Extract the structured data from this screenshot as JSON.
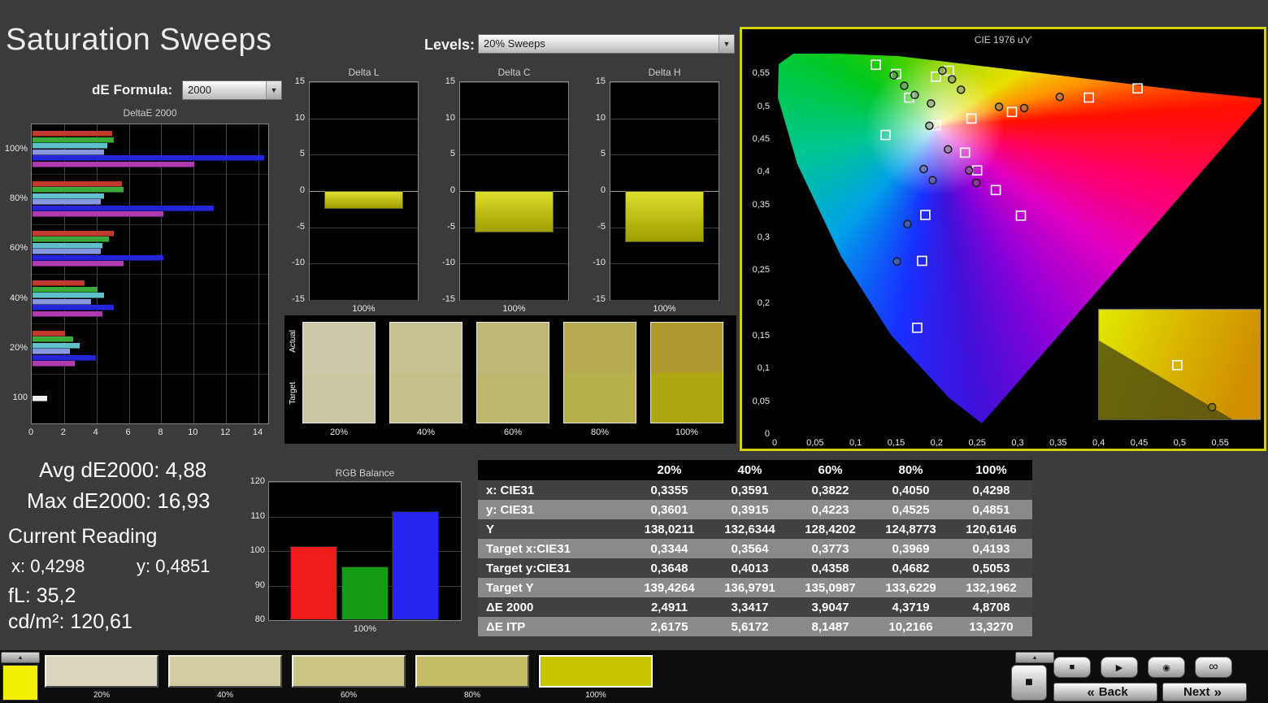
{
  "window": {
    "title": "Saturation Sweeps"
  },
  "controls": {
    "de_formula_label": "dE Formula:",
    "de_formula_value": "2000",
    "levels_label": "Levels:",
    "levels_value": "20% Sweeps",
    "dropdown_arrow": "▼"
  },
  "stats": {
    "avg": "Avg dE2000: 4,88",
    "max": "Max dE2000: 16,93",
    "current_reading": "Current Reading",
    "x": "x: 0,4298",
    "y": "y: 0,4851",
    "fl": "fL: 35,2",
    "cd": "cd/m²: 120,61"
  },
  "chart_data": [
    {
      "id": "deltaE2000",
      "type": "bar",
      "orientation": "horizontal",
      "title": "DeltaE 2000",
      "xlim": [
        0,
        14.6
      ],
      "xticks": [
        0,
        2,
        4,
        6,
        8,
        10,
        12,
        14
      ],
      "series_colors": [
        "#c23a2e",
        "#3aa83a",
        "#62c0cc",
        "#8898e0",
        "#2424d8",
        "#b03ab0"
      ],
      "groups": [
        {
          "label": "100%",
          "values": [
            4.9,
            5.0,
            4.6,
            4.4,
            14.3,
            10.0
          ]
        },
        {
          "label": "80%",
          "values": [
            5.5,
            5.6,
            4.4,
            4.2,
            11.2,
            8.1
          ]
        },
        {
          "label": "60%",
          "values": [
            5.0,
            4.7,
            4.3,
            4.2,
            8.1,
            5.6
          ]
        },
        {
          "label": "40%",
          "values": [
            3.2,
            4.0,
            4.4,
            3.6,
            5.0,
            4.3
          ]
        },
        {
          "label": "20%",
          "values": [
            2.0,
            2.5,
            2.9,
            2.3,
            3.9,
            2.6
          ]
        },
        {
          "label": "100",
          "values": [
            0.9
          ],
          "colors": [
            "#f0f0f0"
          ]
        }
      ]
    },
    {
      "id": "delta_l",
      "type": "bar",
      "title": "Delta L",
      "ylim": [
        -15,
        15
      ],
      "yticks": [
        15,
        10,
        5,
        0,
        -5,
        -10,
        -15
      ],
      "categories": [
        "100%"
      ],
      "values": [
        -2.5
      ],
      "bar_color": "#cccc00"
    },
    {
      "id": "delta_c",
      "type": "bar",
      "title": "Delta C",
      "ylim": [
        -15,
        15
      ],
      "yticks": [
        15,
        10,
        5,
        0,
        -5,
        -10,
        -15
      ],
      "categories": [
        "100%"
      ],
      "values": [
        -5.7
      ],
      "bar_color": "#cccc00"
    },
    {
      "id": "delta_h",
      "type": "bar",
      "title": "Delta H",
      "ylim": [
        -15,
        15
      ],
      "yticks": [
        15,
        10,
        5,
        0,
        -5,
        -10,
        -15
      ],
      "categories": [
        "100%"
      ],
      "values": [
        -7.1
      ],
      "bar_color": "#cccc00"
    },
    {
      "id": "rgb_balance",
      "type": "bar",
      "title": "RGB Balance",
      "ylim": [
        80,
        120
      ],
      "yticks": [
        120,
        110,
        100,
        90,
        80
      ],
      "categories": [
        "100%"
      ],
      "series": [
        {
          "name": "red",
          "color": "#ee1c1c",
          "value": 101.5
        },
        {
          "name": "green",
          "color": "#149c14",
          "value": 95.5
        },
        {
          "name": "blue",
          "color": "#2626ee",
          "value": 111.5
        }
      ]
    },
    {
      "id": "cie1976",
      "type": "scatter",
      "title": "CIE 1976 u'v'",
      "xlim": [
        0,
        0.6
      ],
      "ylim": [
        0,
        0.58
      ],
      "xtick_labels": [
        "0",
        "0,05",
        "0,1",
        "0,15",
        "0,2",
        "0,25",
        "0,3",
        "0,35",
        "0,4",
        "0,45",
        "0,5",
        "0,55"
      ],
      "ytick_labels": [
        "0,55",
        "0,5",
        "0,45",
        "0,4",
        "0,35",
        "0,3",
        "0,25",
        "0,2",
        "0,15",
        "0,1",
        "0,05",
        "0"
      ],
      "targets_uv": [
        [
          0.125,
          0.563
        ],
        [
          0.15,
          0.549
        ],
        [
          0.215,
          0.554
        ],
        [
          0.199,
          0.545
        ],
        [
          0.166,
          0.513
        ],
        [
          0.448,
          0.527
        ],
        [
          0.388,
          0.513
        ],
        [
          0.293,
          0.491
        ],
        [
          0.243,
          0.481
        ],
        [
          0.199,
          0.471
        ],
        [
          0.137,
          0.456
        ],
        [
          0.235,
          0.429
        ],
        [
          0.25,
          0.402
        ],
        [
          0.273,
          0.372
        ],
        [
          0.304,
          0.333
        ],
        [
          0.186,
          0.334
        ],
        [
          0.182,
          0.264
        ],
        [
          0.176,
          0.162
        ]
      ],
      "measurements_uv": [
        [
          0.147,
          0.547
        ],
        [
          0.16,
          0.531
        ],
        [
          0.173,
          0.517
        ],
        [
          0.193,
          0.504
        ],
        [
          0.207,
          0.554
        ],
        [
          0.219,
          0.541
        ],
        [
          0.23,
          0.525
        ],
        [
          0.277,
          0.499
        ],
        [
          0.308,
          0.497
        ],
        [
          0.352,
          0.514
        ],
        [
          0.191,
          0.47
        ],
        [
          0.214,
          0.434
        ],
        [
          0.184,
          0.404
        ],
        [
          0.195,
          0.387
        ],
        [
          0.24,
          0.402
        ],
        [
          0.249,
          0.383
        ],
        [
          0.164,
          0.32
        ],
        [
          0.151,
          0.263
        ]
      ],
      "inset": {
        "u": 0.4,
        "v": 0.022,
        "w": 0.2,
        "h": 0.168,
        "square_uv": [
          0.497,
          0.105
        ],
        "dot_uv": [
          0.54,
          0.041
        ]
      }
    }
  ],
  "patches": {
    "row_label_actual": "Actual",
    "row_label_target": "Target",
    "items": [
      {
        "label": "20%",
        "actual": "#cdc9ad",
        "target": "#cbc7a3"
      },
      {
        "label": "40%",
        "actual": "#c6c192",
        "target": "#c4c08a"
      },
      {
        "label": "60%",
        "actual": "#bfb878",
        "target": "#bdb76b"
      },
      {
        "label": "80%",
        "actual": "#b7ab52",
        "target": "#b5b04a"
      },
      {
        "label": "100%",
        "actual": "#b09a30",
        "target": "#ada712"
      }
    ]
  },
  "table": {
    "columns": [
      "20%",
      "40%",
      "60%",
      "80%",
      "100%"
    ],
    "rows": [
      {
        "label": "x: CIE31",
        "values": [
          "0,3355",
          "0,3591",
          "0,3822",
          "0,4050",
          "0,4298"
        ]
      },
      {
        "label": "y: CIE31",
        "values": [
          "0,3601",
          "0,3915",
          "0,4223",
          "0,4525",
          "0,4851"
        ]
      },
      {
        "label": "Y",
        "values": [
          "138,0211",
          "132,6344",
          "128,4202",
          "124,8773",
          "120,6146"
        ]
      },
      {
        "label": "Target x:CIE31",
        "values": [
          "0,3344",
          "0,3564",
          "0,3773",
          "0,3969",
          "0,4193"
        ]
      },
      {
        "label": "Target y:CIE31",
        "values": [
          "0,3648",
          "0,4013",
          "0,4358",
          "0,4682",
          "0,5053"
        ]
      },
      {
        "label": "Target Y",
        "values": [
          "139,4264",
          "136,9791",
          "135,0987",
          "133,6229",
          "132,1962"
        ]
      },
      {
        "label": "ΔE 2000",
        "values": [
          "2,4911",
          "3,3417",
          "3,9047",
          "4,3719",
          "4,8708"
        ]
      },
      {
        "label": "ΔE ITP",
        "values": [
          "2,6175",
          "5,6172",
          "8,1487",
          "10,2166",
          "13,3270"
        ]
      }
    ]
  },
  "toolbar": {
    "current_patch_color": "#f2f200",
    "collapse_icon": "▲",
    "square_icon": "■",
    "patches": [
      {
        "label": "20%",
        "color": "#dad7bc",
        "selected": false
      },
      {
        "label": "40%",
        "color": "#d3cea2",
        "selected": false
      },
      {
        "label": "60%",
        "color": "#ccc686",
        "selected": false
      },
      {
        "label": "80%",
        "color": "#c5bc64",
        "selected": false
      },
      {
        "label": "100%",
        "color": "#c9c400",
        "selected": true
      }
    ],
    "media_buttons": [
      {
        "name": "stop",
        "icon": "■"
      },
      {
        "name": "play",
        "icon": "▶"
      },
      {
        "name": "record",
        "icon": "◉"
      },
      {
        "name": "loop",
        "icon": "∞"
      }
    ],
    "back_icon": "«",
    "back_label": "Back",
    "next_label": "Next",
    "next_icon": "»"
  },
  "colors": {
    "accent_yellow": "#cfd400",
    "background": "#3b3b3b"
  }
}
